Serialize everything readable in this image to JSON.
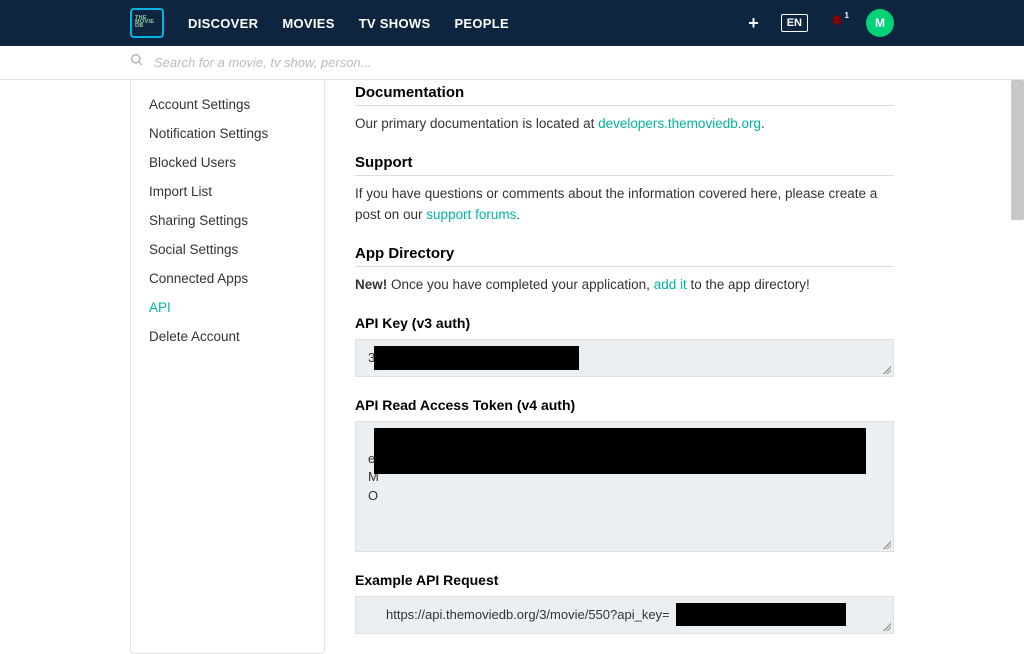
{
  "header": {
    "logo_lines": [
      "THE",
      "MOVIE",
      "DB"
    ],
    "nav": [
      "DISCOVER",
      "MOVIES",
      "TV SHOWS",
      "PEOPLE"
    ],
    "lang": "EN",
    "notif_count": "1",
    "avatar_initial": "M"
  },
  "search": {
    "placeholder": "Search for a movie, tv show, person..."
  },
  "sidebar": {
    "items": [
      {
        "label": "Account Settings",
        "active": false
      },
      {
        "label": "Notification Settings",
        "active": false
      },
      {
        "label": "Blocked Users",
        "active": false
      },
      {
        "label": "Import List",
        "active": false
      },
      {
        "label": "Sharing Settings",
        "active": false
      },
      {
        "label": "Social Settings",
        "active": false
      },
      {
        "label": "Connected Apps",
        "active": false
      },
      {
        "label": "API",
        "active": true
      },
      {
        "label": "Delete Account",
        "active": false
      }
    ]
  },
  "main": {
    "documentation": {
      "heading": "Documentation",
      "text_pre": "Our primary documentation is located at ",
      "link": "developers.themoviedb.org",
      "text_post": "."
    },
    "support": {
      "heading": "Support",
      "text_pre": "If you have questions or comments about the information covered here, please create a post on our ",
      "link": "support forums",
      "text_post": "."
    },
    "app_directory": {
      "heading": "App Directory",
      "new": "New!",
      "text_pre": " Once you have completed your application, ",
      "link": "add it",
      "text_post": " to the app directory!"
    },
    "api_key": {
      "label": "API Key (v3 auth)",
      "prefix": "3"
    },
    "access_token": {
      "label": "API Read Access Token (v4 auth)",
      "lines": "e\nM\nO"
    },
    "example_request": {
      "label": "Example API Request",
      "prefix": "https://api.themoviedb.org/3/movie/550?api_key="
    }
  }
}
